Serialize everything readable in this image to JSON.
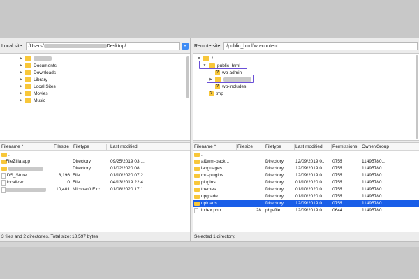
{
  "left": {
    "site_label": "Local site:",
    "site_path_prefix": "/Users/",
    "site_path_suffix": "Desktop/",
    "tree_items": [
      "Documents",
      "Downloads",
      "Library",
      "Local Sites",
      "Movies",
      "Music"
    ],
    "columns": [
      "Filename",
      "Filesize",
      "Filetype",
      "Last modified"
    ],
    "sort_arrow": "^",
    "rows": [
      {
        "name": "..",
        "size": "",
        "type": "",
        "modified": ""
      },
      {
        "name": "FileZilla.app",
        "size": "",
        "type": "Directory",
        "modified": "09/25/2019 03:..."
      },
      {
        "name": "",
        "size": "",
        "type": "Directory",
        "modified": "01/02/2020 08:..."
      },
      {
        "name": ".DS_Store",
        "size": "8,196",
        "type": "File",
        "modified": "01/10/2020 07:2..."
      },
      {
        "name": ".localized",
        "size": "0",
        "type": "File",
        "modified": "04/13/2019 22:4..."
      },
      {
        "name": "",
        "size": "10,401",
        "type": "Microsoft Exc...",
        "modified": "01/08/2020 17:1..."
      }
    ],
    "status": "3 files and 2 directories. Total size: 18,597 bytes"
  },
  "right": {
    "site_label": "Remote site:",
    "site_path": "/public_html/wp-content",
    "tree": {
      "root": "/",
      "public_html": "public_html",
      "wp_admin": "wp-admin",
      "wp_includes": "wp-includes",
      "tmp": "tmp",
      "question_mark": "?"
    },
    "columns": [
      "Filename",
      "Filesize",
      "Filetype",
      "Last modified",
      "Permissions",
      "Owner/Group"
    ],
    "sort_arrow": "^",
    "rows": [
      {
        "name": "..",
        "size": "",
        "type": "",
        "modified": "",
        "perms": "",
        "owner": "",
        "kind": "folder"
      },
      {
        "name": "ai1wm-back...",
        "size": "",
        "type": "Directory",
        "modified": "12/09/2019 0...",
        "perms": "0755",
        "owner": "11495780...",
        "kind": "folder"
      },
      {
        "name": "languages",
        "size": "",
        "type": "Directory",
        "modified": "12/09/2019 0...",
        "perms": "0755",
        "owner": "11495780...",
        "kind": "folder"
      },
      {
        "name": "mu-plugins",
        "size": "",
        "type": "Directory",
        "modified": "12/09/2019 0...",
        "perms": "0755",
        "owner": "11495780...",
        "kind": "folder"
      },
      {
        "name": "plugins",
        "size": "",
        "type": "Directory",
        "modified": "01/10/2020 0...",
        "perms": "0755",
        "owner": "11495780...",
        "kind": "folder"
      },
      {
        "name": "themes",
        "size": "",
        "type": "Directory",
        "modified": "01/10/2020 0...",
        "perms": "0755",
        "owner": "11495780...",
        "kind": "folder"
      },
      {
        "name": "upgrade",
        "size": "",
        "type": "Directory",
        "modified": "01/10/2020 0...",
        "perms": "0755",
        "owner": "11495780...",
        "kind": "folder"
      },
      {
        "name": "uploads",
        "size": "",
        "type": "Directory",
        "modified": "12/09/2019 0...",
        "perms": "0755",
        "owner": "11495780...",
        "kind": "folder",
        "selected": true
      },
      {
        "name": "index.php",
        "size": "28",
        "type": "php-file",
        "modified": "12/09/2019 0...",
        "perms": "0644",
        "owner": "11495780...",
        "kind": "file"
      }
    ],
    "status": "Selected 1 directory."
  },
  "colors": {
    "selection": "#1a5ee8",
    "folder": "#f8c73a",
    "highlight_box": "#6a4fd8",
    "dropdown": "#3d8bf5"
  }
}
